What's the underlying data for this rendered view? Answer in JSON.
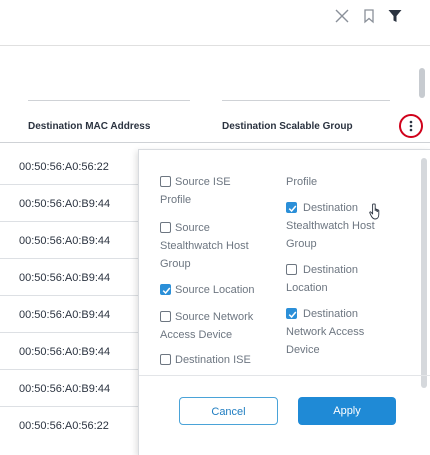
{
  "toolbar": {
    "icons": [
      "close-icon",
      "bookmark-icon",
      "filter-icon"
    ]
  },
  "table": {
    "columns": [
      "Destination MAC Address",
      "Destination Scalable Group"
    ],
    "rows": [
      "00:50:56:A0:56:22",
      "00:50:56:A0:B9:44",
      "00:50:56:A0:B9:44",
      "00:50:56:A0:B9:44",
      "00:50:56:A0:B9:44",
      "00:50:56:A0:B9:44",
      "00:50:56:A0:B9:44",
      "00:50:56:A0:56:22"
    ]
  },
  "column_options": {
    "left": [
      {
        "label_lines": [
          "Source ISE",
          "Profile"
        ],
        "checked": false
      },
      {
        "label_lines": [
          "Source",
          "Stealthwatch Host",
          "Group"
        ],
        "checked": false
      },
      {
        "label_lines": [
          "Source Location"
        ],
        "checked": true
      },
      {
        "label_lines": [
          "Source Network",
          "Access Device"
        ],
        "checked": false
      },
      {
        "label_lines": [
          "Destination ISE"
        ],
        "checked": false
      }
    ],
    "right": [
      {
        "label_lines": [
          "Profile"
        ],
        "checked": null
      },
      {
        "label_lines": [
          "Destination",
          "Stealthwatch Host",
          "Group"
        ],
        "checked": true
      },
      {
        "label_lines": [
          "Destination",
          "Location"
        ],
        "checked": false
      },
      {
        "label_lines": [
          "Destination",
          "Network Access",
          "Device"
        ],
        "checked": true
      }
    ]
  },
  "buttons": {
    "cancel": "Cancel",
    "apply": "Apply"
  },
  "colors": {
    "accent": "#1f8ad6",
    "highlight_ring": "#d0021b"
  }
}
